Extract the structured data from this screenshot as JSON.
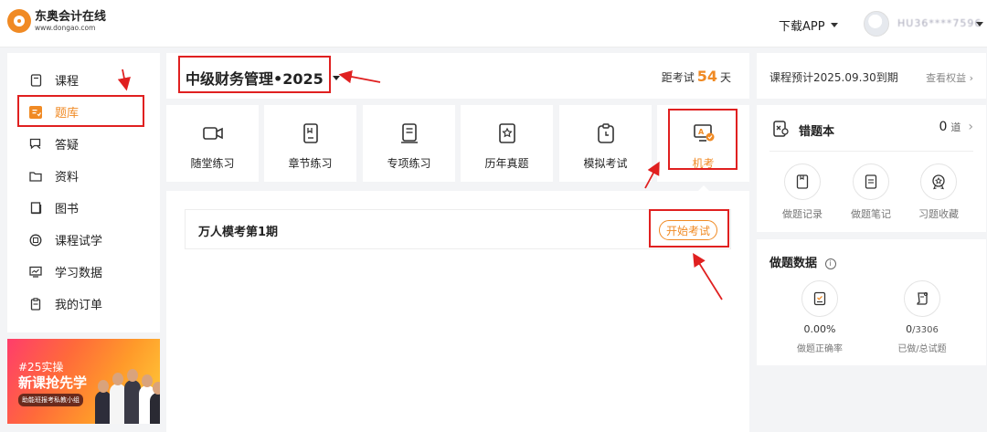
{
  "header": {
    "logo_cn": "东奥会计在线",
    "logo_url": "www.dongao.com",
    "download_label": "下载APP",
    "username": "HU36****7596"
  },
  "sidebar": {
    "items": [
      {
        "label": "课程",
        "icon": "book-icon"
      },
      {
        "label": "题库",
        "icon": "question-bank-icon"
      },
      {
        "label": "答疑",
        "icon": "chat-icon"
      },
      {
        "label": "资料",
        "icon": "folder-icon"
      },
      {
        "label": "图书",
        "icon": "books-icon"
      },
      {
        "label": "课程试学",
        "icon": "trial-icon"
      },
      {
        "label": "学习数据",
        "icon": "chart-icon"
      },
      {
        "label": "我的订单",
        "icon": "order-icon"
      }
    ],
    "active_index": 1
  },
  "banner": {
    "line1": "#25实操",
    "line2": "新课抢先学",
    "line3": "助能班报考私教小组"
  },
  "course": {
    "title": "中级财务管理•2025",
    "exam_prefix": "距考试",
    "exam_days": "54",
    "exam_suffix": "天"
  },
  "tiles": [
    {
      "label": "随堂练习",
      "icon": "video-icon"
    },
    {
      "label": "章节练习",
      "icon": "chapter-icon"
    },
    {
      "label": "专项练习",
      "icon": "special-icon"
    },
    {
      "label": "历年真题",
      "icon": "star-doc-icon"
    },
    {
      "label": "模拟考试",
      "icon": "clipboard-icon"
    },
    {
      "label": "机考",
      "icon": "computer-exam-icon"
    }
  ],
  "active_tile_index": 5,
  "exam": {
    "name": "万人模考第1期",
    "start_label": "开始考试"
  },
  "right": {
    "validity": "课程预计2025.09.30到期",
    "benefit": "查看权益",
    "wrong_book": {
      "title": "错题本",
      "count": "0",
      "unit": "道",
      "actions": [
        {
          "label": "做题记录",
          "icon": "record-icon"
        },
        {
          "label": "做题笔记",
          "icon": "note-icon"
        },
        {
          "label": "习题收藏",
          "icon": "badge-icon"
        }
      ]
    },
    "data": {
      "title": "做题数据",
      "accuracy_value": "0.00%",
      "accuracy_label": "做题正确率",
      "done_value": "0",
      "done_total": "/3306",
      "done_label": "已做/总试题"
    }
  },
  "colors": {
    "accent": "#f08a24",
    "annotation": "#e02020"
  }
}
